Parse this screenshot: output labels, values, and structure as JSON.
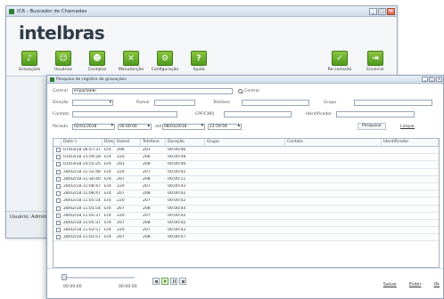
{
  "main": {
    "title": "ICR - Buscador de Chamadas",
    "brand": "intelbras",
    "toolbar": [
      {
        "label": "Gravações",
        "icon": "recording-icon",
        "glyph": "♪"
      },
      {
        "label": "Usuários",
        "icon": "users-icon",
        "glyph": "☺"
      },
      {
        "label": "Contatos",
        "icon": "contacts-icon",
        "glyph": "☻"
      },
      {
        "label": "Manutenção",
        "icon": "tools-icon",
        "glyph": "✕"
      },
      {
        "label": "Configuração",
        "icon": "gear-icon",
        "glyph": "⚙"
      },
      {
        "label": "Ajuda",
        "icon": "help-icon",
        "glyph": "?"
      }
    ],
    "right_tools": [
      {
        "label": "Re-conexão",
        "icon": "reconnect-icon",
        "glyph": "✓"
      },
      {
        "label": "Encerrar",
        "icon": "exit-icon",
        "glyph": "⇥"
      }
    ],
    "status_user": "Usuário: Administr"
  },
  "dialog": {
    "title": "Pesquisa de registro de gravações",
    "filters": {
      "central_label": "Central",
      "central_value": "Impacta68i",
      "central_link": "Central",
      "direcao_label": "Direção",
      "ramal_label": "Ramal",
      "telefone_label": "Telefone",
      "grupo_label": "Grupo",
      "contato_label": "Contato",
      "cpf_label": "CPF/CNPJ",
      "ident_label": "Identificador",
      "periodo_label": "Período",
      "date_from": "02/01/2018",
      "time_from": "00:00:00",
      "ate_label": "até",
      "date_to": "08/03/2018",
      "time_to": "23:59:59",
      "pesquisar": "Pesquisar",
      "limpar": "Limpar"
    },
    "columns": [
      "Data ▽",
      "Direção",
      "Ramal",
      "Telefone",
      "Duração",
      "Grupo",
      "Contato",
      "Identificador"
    ],
    "rows": [
      {
        "data": "07/03/18 16:57:37",
        "dir": "Ent",
        "ramal": "206",
        "tel": "201",
        "dur": "00:00:06"
      },
      {
        "data": "01/03/18 15:59:28",
        "dir": "Ent",
        "ramal": "220",
        "tel": "206",
        "dur": "00:00:08"
      },
      {
        "data": "01/03/18 14:55:25",
        "dir": "Ent",
        "ramal": "201",
        "tel": "208",
        "dur": "00:00:06"
      },
      {
        "data": "28/02/18 11:32:48",
        "dir": "Ent",
        "ramal": "220",
        "tel": "207",
        "dur": "00:00:02"
      },
      {
        "data": "28/02/18 11:30:40",
        "dir": "Ent",
        "ramal": "207",
        "tel": "208",
        "dur": "00:00:11"
      },
      {
        "data": "28/02/18 11:08:47",
        "dir": "Ent",
        "ramal": "220",
        "tel": "207",
        "dur": "00:00:02"
      },
      {
        "data": "28/02/18 11:08:47",
        "dir": "Ent",
        "ramal": "207",
        "tel": "208",
        "dur": "00:00:02"
      },
      {
        "data": "28/02/18 11:05:54",
        "dir": "Ent",
        "ramal": "220",
        "tel": "207",
        "dur": "00:00:02"
      },
      {
        "data": "28/02/18 11:05:54",
        "dir": "Ent",
        "ramal": "207",
        "tel": "208",
        "dur": "00:00:04"
      },
      {
        "data": "28/02/18 11:05:37",
        "dir": "Ent",
        "ramal": "220",
        "tel": "207",
        "dur": "00:00:02"
      },
      {
        "data": "28/02/18 11:05:37",
        "dir": "Ent",
        "ramal": "207",
        "tel": "208",
        "dur": "00:00:02"
      },
      {
        "data": "28/02/18 11:03:57",
        "dir": "Ent",
        "ramal": "220",
        "tel": "207",
        "dur": "00:00:02"
      },
      {
        "data": "28/02/18 11:03:57",
        "dir": "Ent",
        "ramal": "207",
        "tel": "208",
        "dur": "00:00:07"
      }
    ],
    "footer": {
      "time_start": "00:00:00",
      "time_end": "00:00:00",
      "salvar": "Salvar",
      "exibir": "Exibir",
      "ok": "Ok"
    }
  }
}
